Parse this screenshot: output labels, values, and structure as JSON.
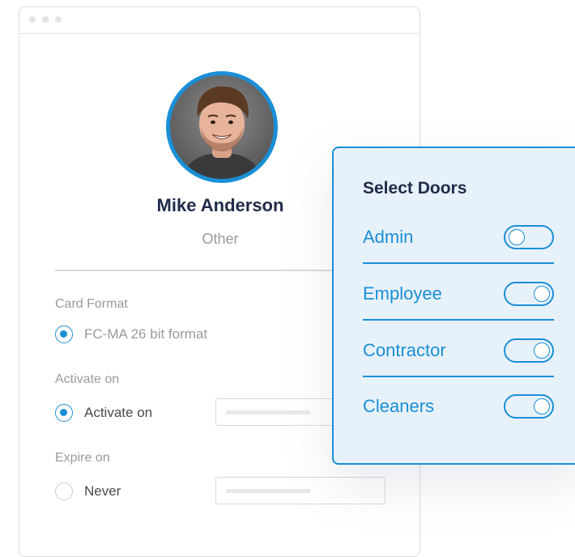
{
  "profile": {
    "name": "Mike Anderson",
    "role": "Other"
  },
  "card_format": {
    "label": "Card Format",
    "option": "FC-MA 26 bit format",
    "selected": true
  },
  "activate": {
    "label": "Activate on",
    "option": "Activate on",
    "selected": true
  },
  "expire": {
    "label": "Expire on",
    "option": "Never",
    "selected": false
  },
  "doors_panel": {
    "title": "Select Doors",
    "accent": "#1a8fd6",
    "doors": [
      {
        "label": "Admin",
        "on": false
      },
      {
        "label": "Employee",
        "on": true
      },
      {
        "label": "Contractor",
        "on": true
      },
      {
        "label": "Cleaners",
        "on": true
      }
    ]
  }
}
